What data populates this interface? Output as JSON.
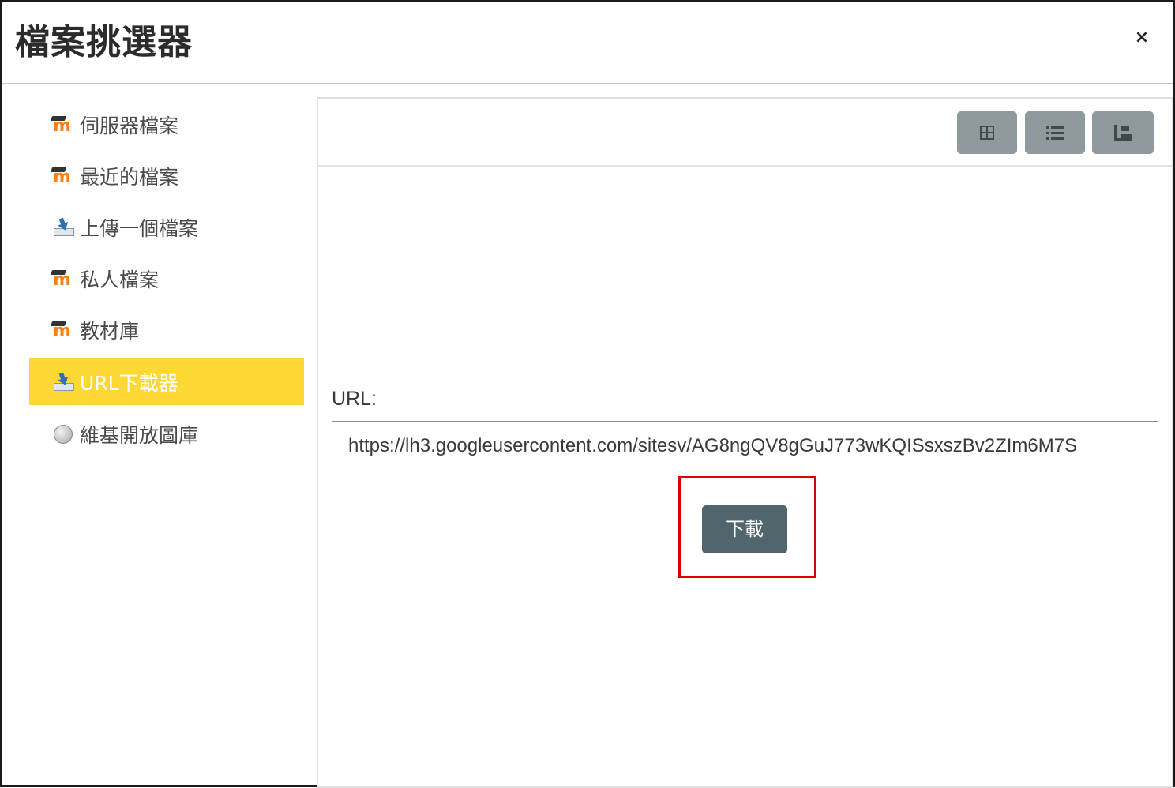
{
  "dialog": {
    "title": "檔案挑選器",
    "close_label": "×"
  },
  "sidebar": {
    "items": [
      {
        "label": "伺服器檔案",
        "icon": "moodle-icon",
        "active": false
      },
      {
        "label": "最近的檔案",
        "icon": "moodle-icon",
        "active": false
      },
      {
        "label": "上傳一個檔案",
        "icon": "upload-icon",
        "active": false
      },
      {
        "label": "私人檔案",
        "icon": "moodle-icon",
        "active": false
      },
      {
        "label": "教材庫",
        "icon": "moodle-icon",
        "active": false
      },
      {
        "label": "URL下載器",
        "icon": "upload-icon",
        "active": true
      },
      {
        "label": "維基開放圖庫",
        "icon": "wikimedia-icon",
        "active": false
      }
    ]
  },
  "toolbar": {
    "views": [
      "grid-view-icon",
      "list-view-icon",
      "tree-view-icon"
    ]
  },
  "main": {
    "url_label": "URL:",
    "url_value": "https://lh3.googleusercontent.com/sitesv/AG8ngQV8gGuJ773wKQISsxszBv2ZIm6M7S",
    "download_label": "下載"
  },
  "colors": {
    "active_item": "#fdd835",
    "button_gray": "#8f9a9f",
    "download_button": "#51656d",
    "highlight": "#e00000"
  }
}
